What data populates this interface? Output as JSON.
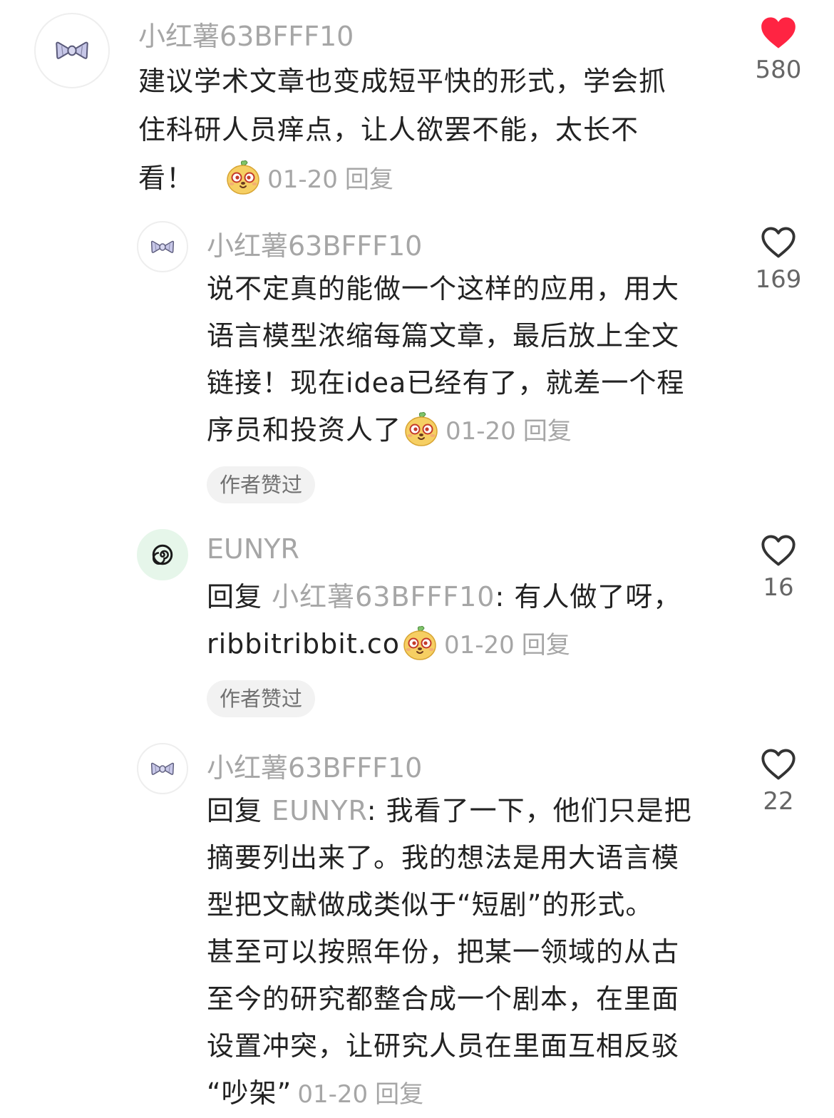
{
  "comments": [
    {
      "username": "小红薯63BFFF10",
      "lines": [
        "建议学术文章也变成短平快的形式，学会抓",
        "住科研人员痒点，让人欲罢不能，太长不",
        "看！"
      ],
      "date": "01-20",
      "reply_label": "回复",
      "likes": "580",
      "liked": true
    },
    {
      "username": "小红薯63BFFF10",
      "lines": [
        "说不定真的能做一个这样的应用，用大",
        "语言模型浓缩每篇文章，最后放上全文",
        "链接！现在idea已经有了，就差一个程",
        "序员和投资人了"
      ],
      "date": "01-20",
      "reply_label": "回复",
      "badge": "作者赞过",
      "likes": "169",
      "liked": false
    },
    {
      "username": "EUNYR",
      "prefix": "回复 ",
      "mention": "小红薯63BFFF10",
      "lines": [
        ": 有人做了呀，",
        "ribbitribbit.co"
      ],
      "date": "01-20",
      "reply_label": "回复",
      "badge": "作者赞过",
      "likes": "16",
      "liked": false
    },
    {
      "username": "小红薯63BFFF10",
      "prefix": "回复 ",
      "mention": "EUNYR",
      "lines": [
        ": 我看了一下，他们只是把",
        "摘要列出来了。我的想法是用大语言模",
        "型把文献做成类似于“短剧”的形式。",
        "甚至可以按照年份，把某一领域的从古",
        "至今的研究都整合成一个剧本，在里面",
        "设置冲突，让研究人员在里面互相反驳",
        "“吵架”"
      ],
      "date": "01-20",
      "reply_label": "回复",
      "likes": "22",
      "liked": false
    }
  ],
  "colors": {
    "heart_liked": "#ff2442",
    "heart_outline": "#333333",
    "secondary_text": "#a6a6a6",
    "body_text": "#222222",
    "badge_bg": "#f2f2f2"
  },
  "icons": {
    "bow_avatar": "bow-tie-icon",
    "swirl_avatar": "swirl-icon",
    "emoji": "smiling-potato-emoji-icon",
    "like_filled": "heart-filled-icon",
    "like_outline": "heart-outline-icon"
  }
}
